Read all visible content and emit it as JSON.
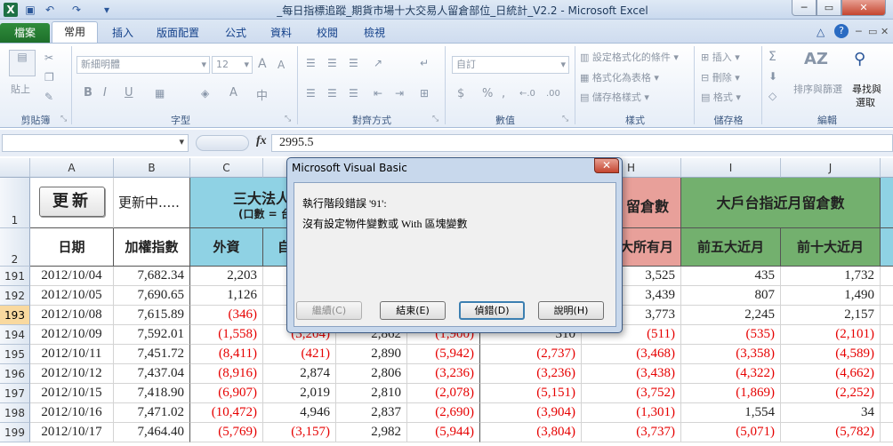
{
  "window": {
    "title": "_每日指標追蹤_期貨市場十大交易人留倉部位_日統計_V2.2  -  Microsoft Excel",
    "app_badge": "X",
    "minimize": "─",
    "restore": "▭",
    "close": "✕",
    "doc_minimize": "─",
    "doc_restore": "▭",
    "doc_close": "✕"
  },
  "ribbon": {
    "tabs": [
      "檔案",
      "常用",
      "插入",
      "版面配置",
      "公式",
      "資料",
      "校閱",
      "檢視"
    ],
    "active_tab": "常用",
    "groups": {
      "clipboard": {
        "label": "剪貼簿",
        "paste": "貼上"
      },
      "font": {
        "label": "字型",
        "font_name": "新細明體",
        "font_size": "12",
        "bold": "B",
        "italic": "I",
        "underline": "U",
        "wen": "中",
        "grow": "A",
        "shrink": "A"
      },
      "alignment": {
        "label": "對齊方式"
      },
      "number": {
        "label": "數值",
        "format": "自訂",
        "currency": "$",
        "percent": "%",
        "comma": ",",
        "inc_dec": "←.0",
        "dec_dec": ".00"
      },
      "styles": {
        "label": "樣式",
        "conditional": "設定格式化的條件",
        "as_table": "格式化為表格",
        "cell_styles": "儲存格樣式"
      },
      "cells": {
        "label": "儲存格",
        "insert": "插入",
        "delete": "刪除",
        "format": "格式"
      },
      "editing": {
        "label": "編輯",
        "sort_filter": "排序與篩選",
        "find_select_1": "尋找與",
        "find_select_2": "選取"
      }
    }
  },
  "formula_bar": {
    "fx": "fx",
    "value": "2995.5"
  },
  "sheet": {
    "columns": [
      "A",
      "B",
      "C",
      "D",
      "E",
      "F",
      "G",
      "H",
      "I",
      "J"
    ],
    "header_row1": {
      "row_num": "1",
      "update_button": "更新",
      "updating": "更新中.....",
      "group_left_title": "三大法人",
      "group_left_sub": "(口數 = 台",
      "group_mid_title": "留倉數",
      "group_right_title": "大戶台指近月留倉數"
    },
    "header_row2": {
      "row_num": "2",
      "date": "日期",
      "index": "加權指數",
      "foreign": "外資",
      "self": "自",
      "all_month": "大所有月",
      "top5": "前五大近月",
      "top10": "前十大近月"
    },
    "rows": [
      {
        "num": "191",
        "date": "2012/10/04",
        "index": "7,682.34",
        "c": "2,203",
        "d": "",
        "e": "",
        "f": "",
        "g": "",
        "h": "3,525",
        "i": "435",
        "j": "1,732"
      },
      {
        "num": "192",
        "date": "2012/10/05",
        "index": "7,690.65",
        "c": "1,126",
        "d": "",
        "e": "",
        "f": "",
        "g": "",
        "h": "3,439",
        "i": "807",
        "j": "1,490"
      },
      {
        "num": "193",
        "date": "2012/10/08",
        "index": "7,615.89",
        "c": "(346)",
        "d": "",
        "e": "",
        "f": "",
        "g": "",
        "h": "3,773",
        "i": "2,245",
        "j": "2,157"
      },
      {
        "num": "194",
        "date": "2012/10/09",
        "index": "7,592.01",
        "c": "(1,558)",
        "d": "(3,204)",
        "e": "2,862",
        "f": "(1,900)",
        "g": "310",
        "h": "(511)",
        "i": "(535)",
        "j": "(2,101)"
      },
      {
        "num": "195",
        "date": "2012/10/11",
        "index": "7,451.72",
        "c": "(8,411)",
        "d": "(421)",
        "e": "2,890",
        "f": "(5,942)",
        "g": "(2,737)",
        "h": "(3,468)",
        "i": "(3,358)",
        "j": "(4,589)"
      },
      {
        "num": "196",
        "date": "2012/10/12",
        "index": "7,437.04",
        "c": "(8,916)",
        "d": "2,874",
        "e": "2,806",
        "f": "(3,236)",
        "g": "(3,236)",
        "h": "(3,438)",
        "i": "(4,322)",
        "j": "(4,662)"
      },
      {
        "num": "197",
        "date": "2012/10/15",
        "index": "7,418.90",
        "c": "(6,907)",
        "d": "2,019",
        "e": "2,810",
        "f": "(2,078)",
        "g": "(5,151)",
        "h": "(3,752)",
        "i": "(1,869)",
        "j": "(2,252)"
      },
      {
        "num": "198",
        "date": "2012/10/16",
        "index": "7,471.02",
        "c": "(10,472)",
        "d": "4,946",
        "e": "2,837",
        "f": "(2,690)",
        "g": "(3,904)",
        "h": "(1,301)",
        "i": "1,554",
        "j": "34"
      },
      {
        "num": "199",
        "date": "2012/10/17",
        "index": "7,464.40",
        "c": "(5,769)",
        "d": "(3,157)",
        "e": "2,982",
        "f": "(5,944)",
        "g": "(3,804)",
        "h": "(3,737)",
        "i": "(5,071)",
        "j": "(5,782)"
      }
    ],
    "selected_row": "193"
  },
  "dialog": {
    "title": "Microsoft Visual Basic",
    "close": "✕",
    "line1": "執行階段錯誤 '91':",
    "line2": "沒有設定物件變數或 With 區塊變數",
    "buttons": {
      "continue": "繼續(C)",
      "end": "結束(E)",
      "debug": "偵錯(D)",
      "help": "說明(H)"
    }
  },
  "colors": {
    "blue_header": "#8fd2e4",
    "green_header": "#73b06e",
    "pink_header": "#e8a09a",
    "negative": "#e60000"
  }
}
